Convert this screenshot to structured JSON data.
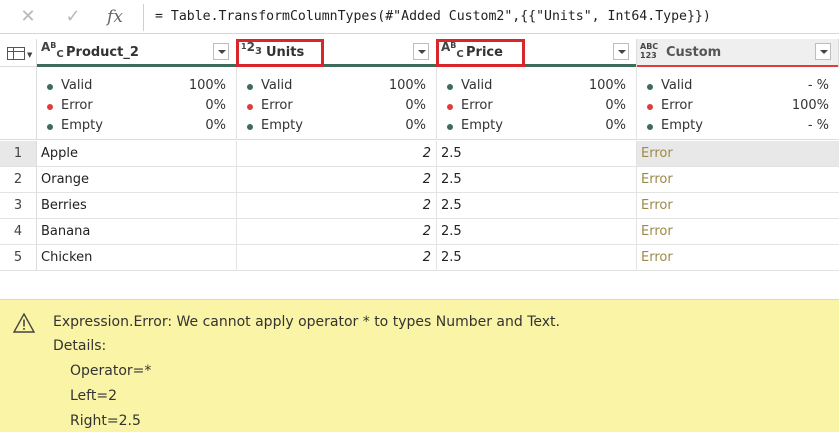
{
  "formula_bar": {
    "cancel_icon": "close-icon",
    "ok_icon": "check-icon",
    "fx_label": "fx",
    "formula": "= Table.TransformColumnTypes(#\"Added Custom2\",{{\"Units\", Int64.Type}})"
  },
  "columns": [
    {
      "name": "Product_2",
      "type_icon": "ABC",
      "type_label_top": "A",
      "type_label_mid": "B",
      "type_label_bot": "C"
    },
    {
      "name": "Units",
      "type_icon": "123",
      "type_label_top": "1",
      "type_label_mid": "2",
      "type_label_bot": "3"
    },
    {
      "name": "Price",
      "type_icon": "ABC",
      "type_label_top": "A",
      "type_label_mid": "B",
      "type_label_bot": "C"
    },
    {
      "name": "Custom",
      "type_icon": "ABC123",
      "type_label_top": "ABC",
      "type_label_bot": "123"
    }
  ],
  "profile": {
    "valid_label": "Valid",
    "error_label": "Error",
    "empty_label": "Empty",
    "stats": [
      {
        "valid": "100%",
        "error": "0%",
        "empty": "0%"
      },
      {
        "valid": "100%",
        "error": "0%",
        "empty": "0%"
      },
      {
        "valid": "100%",
        "error": "0%",
        "empty": "0%"
      },
      {
        "valid": "- %",
        "error": "100%",
        "empty": "- %"
      }
    ]
  },
  "rows": [
    {
      "n": "1",
      "product": "Apple",
      "units": "2",
      "price": "2.5",
      "custom": "Error"
    },
    {
      "n": "2",
      "product": "Orange",
      "units": "2",
      "price": "2.5",
      "custom": "Error"
    },
    {
      "n": "3",
      "product": "Berries",
      "units": "2",
      "price": "2.5",
      "custom": "Error"
    },
    {
      "n": "4",
      "product": "Banana",
      "units": "2",
      "price": "2.5",
      "custom": "Error"
    },
    {
      "n": "5",
      "product": "Chicken",
      "units": "2",
      "price": "2.5",
      "custom": "Error"
    }
  ],
  "error_panel": {
    "icon": "warning-icon",
    "title": "Expression.Error: We cannot apply operator * to types Number and Text.",
    "details_label": "Details:",
    "lines": [
      "Operator=*",
      "Left=2",
      "Right=2.5"
    ]
  },
  "colors": {
    "quality_bar": "#3f6b5b",
    "error_bar": "#e23b3b",
    "highlight_box": "#d8262b",
    "error_panel_bg": "#faf4a6"
  }
}
